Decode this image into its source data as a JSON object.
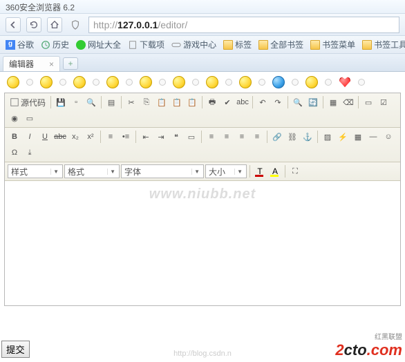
{
  "window": {
    "title": "360安全浏览器 6.2"
  },
  "url": {
    "scheme": "http://",
    "host": "127.0.0.1",
    "path": "/editor/"
  },
  "bookmarks": [
    {
      "label": "谷歌",
      "icon": "google"
    },
    {
      "label": "历史",
      "icon": "clock"
    },
    {
      "label": "网址大全",
      "icon": "green"
    },
    {
      "label": "下载项",
      "icon": "file"
    },
    {
      "label": "游戏中心",
      "icon": "gamepad"
    },
    {
      "label": "标签",
      "icon": "folder"
    },
    {
      "label": "全部书签",
      "icon": "folder"
    },
    {
      "label": "书签菜单",
      "icon": "folder"
    },
    {
      "label": "书签工具",
      "icon": "folder"
    }
  ],
  "tab": {
    "title": "编辑器"
  },
  "toolbar": {
    "source": "源代码",
    "combos": {
      "style": "样式",
      "format": "格式",
      "font": "字体",
      "size": "大小"
    }
  },
  "watermark": "www.niubb.net",
  "footer_url": "http://blog.csdn.n",
  "submit": "提交",
  "logo": {
    "a": "2",
    "b": "cto",
    "c": ".com",
    "sub": "红黑联盟"
  }
}
